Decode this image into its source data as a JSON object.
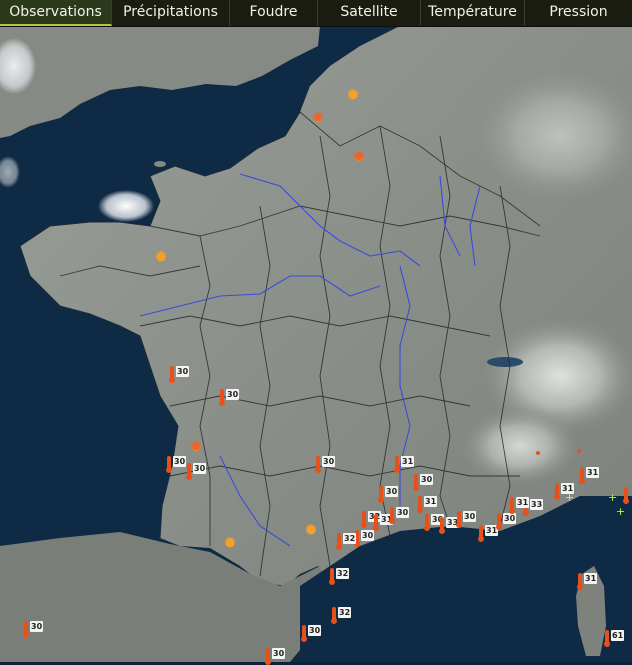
{
  "nav": {
    "tabs": [
      {
        "label": "Observations",
        "active": true
      },
      {
        "label": "Précipitations",
        "active": false
      },
      {
        "label": "Foudre",
        "active": false
      },
      {
        "label": "Satellite",
        "active": false
      },
      {
        "label": "Température",
        "active": false
      },
      {
        "label": "Pression",
        "active": false
      }
    ]
  },
  "colors": {
    "sea": "#0f2a44",
    "land": "#8a8e88",
    "river": "#3a4bdc",
    "thermometer": "#e8501a",
    "sun": "#f5a02a",
    "nav_bg": "#1b1c12"
  },
  "observations": {
    "temperatures": [
      "30",
      "30",
      "30",
      "30",
      "30",
      "31",
      "30",
      "30",
      "31",
      "32",
      "31",
      "30",
      "30",
      "30",
      "33",
      "30",
      "31",
      "30",
      "33",
      "31",
      "31",
      "32",
      "30",
      "32",
      "30",
      "32",
      "31",
      "30",
      "31",
      "61"
    ]
  },
  "weather_symbols": [
    "sun",
    "sun-haze",
    "sun-haze",
    "sun",
    "sun-haze",
    "sun",
    "sun"
  ]
}
